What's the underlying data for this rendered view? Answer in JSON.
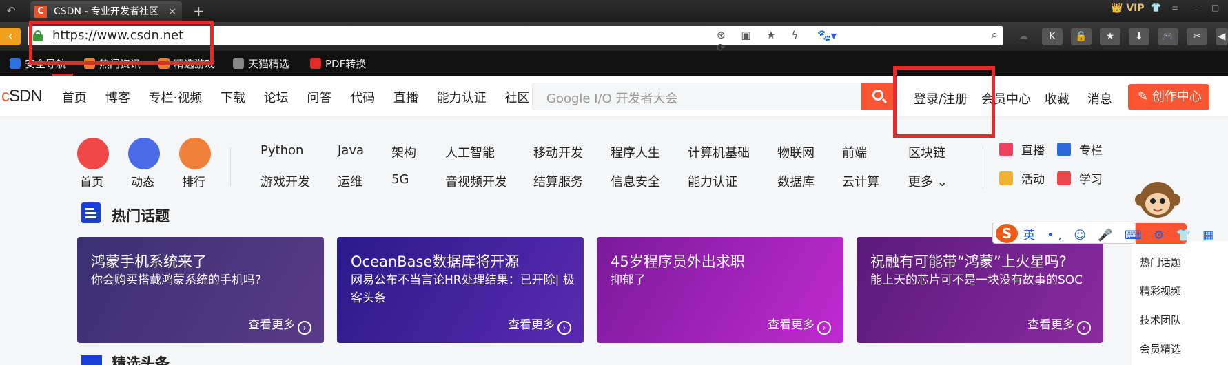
{
  "browser": {
    "tab_title": "CSDN - 专业开发者社区",
    "tab_favicon": "C",
    "tab_close": "×",
    "new_tab": "+",
    "vip_label": "VIP",
    "url": "https://www.csdn.net",
    "url_icons": "⊛ ▣ ★ ϟ ▾ ⟳",
    "toolbar_buttons": [
      "K",
      "🔒",
      "★",
      "⬇",
      "🎮",
      "✂",
      "◀"
    ],
    "bookmarks": [
      {
        "label": "安全导航",
        "color": "#2f6fe0"
      },
      {
        "label": "热门资讯",
        "color": "#f07b2a"
      },
      {
        "label": "精选游戏",
        "color": "#f07b2a"
      },
      {
        "label": "天猫精选",
        "color": "#888888"
      },
      {
        "label": "PDF转换",
        "color": "#e52a2a"
      }
    ]
  },
  "header": {
    "logo_c": "c",
    "logo_rest": "SDN",
    "nav": [
      "首页",
      "博客",
      "专栏·视频",
      "下载",
      "论坛",
      "问答",
      "代码",
      "直播",
      "能力认证",
      "社区"
    ],
    "search_placeholder": "Google I/O 开发者大会",
    "login": "登录/注册",
    "member": "会员中心",
    "favorites": "收藏",
    "messages": "消息",
    "create": "创作中心"
  },
  "quick": [
    {
      "label": "首页",
      "color": "#f04848"
    },
    {
      "label": "动态",
      "color": "#4a6ae8"
    },
    {
      "label": "排行",
      "color": "#f0803a"
    }
  ],
  "categories_row1": [
    "Python",
    "Java",
    "架构",
    "人工智能",
    "移动开发",
    "程序人生",
    "计算机基础",
    "物联网",
    "前端",
    "区块链"
  ],
  "categories_row2": [
    "游戏开发",
    "运维",
    "5G",
    "音视频开发",
    "结算服务",
    "信息安全",
    "能力认证",
    "数据库",
    "云计算",
    "更多 ⌄"
  ],
  "side_links": [
    {
      "label": "直播",
      "color": "#f04060"
    },
    {
      "label": "专栏",
      "color": "#2a6ad8"
    },
    {
      "label": "活动",
      "color": "#f0b030"
    },
    {
      "label": "学习",
      "color": "#e84848"
    }
  ],
  "section_title": "热门话题",
  "cards": [
    {
      "title": "鸿蒙手机系统来了",
      "subtitle": "你会购买搭载鸿蒙系统的手机吗?",
      "more": "查看更多",
      "bg1": "#3a3070",
      "bg2": "#5a3a8a"
    },
    {
      "title": "OceanBase数据库将开源",
      "subtitle": "网易公布不当言论HR处理结果：已开除| 极客头条",
      "more": "查看更多",
      "bg1": "#2a1a8a",
      "bg2": "#5a2ab0"
    },
    {
      "title": "45岁程序员外出求职",
      "subtitle": "抑郁了",
      "more": "查看更多",
      "bg1": "#7a1a9a",
      "bg2": "#c02ad0"
    },
    {
      "title": "祝融有可能带“鸿蒙”上火星吗?",
      "subtitle": "能上天的芯片可不是一块没有故事的SOC",
      "more": "查看更多",
      "bg1": "#5a1a7a",
      "bg2": "#8a2aa0"
    }
  ],
  "ime": {
    "logo": "S",
    "tools": "英 •, ☺ 🎤 ⌨ ⚙ 👕 ▦"
  },
  "right_sidebar": [
    "热门话题",
    "精彩视频",
    "技术团队",
    "会员精选"
  ],
  "next_section_partial": "精选头条",
  "colors": {
    "accent": "#fc5531",
    "highlight_box": "#e52a2a"
  }
}
